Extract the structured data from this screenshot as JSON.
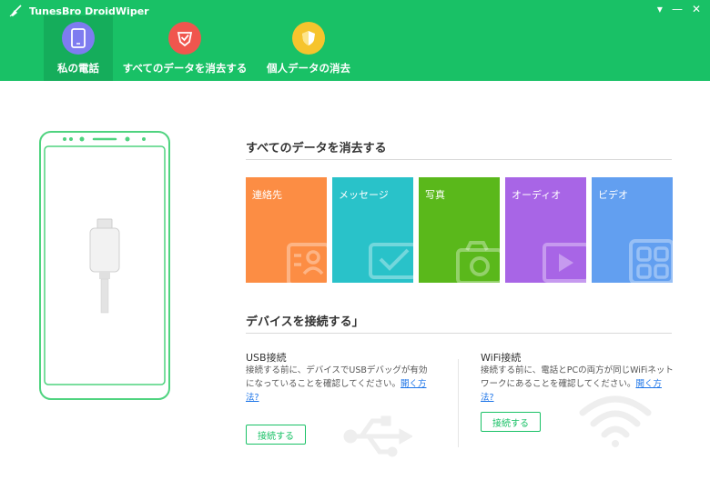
{
  "app": {
    "title": "TunesBro DroidWiper"
  },
  "window_controls": {
    "menu": "▾",
    "minimize": "—",
    "close": "✕"
  },
  "nav": [
    {
      "label": "私の電話",
      "icon": "phone-icon",
      "color": "#7e7cf0",
      "active": true
    },
    {
      "label": "すべてのデータを消去する",
      "icon": "shield-check-icon",
      "color": "#f0564e",
      "active": false
    },
    {
      "label": "個人データの消去",
      "icon": "shield-icon",
      "color": "#f6c42d",
      "active": false
    }
  ],
  "erase_section": {
    "title": "すべてのデータを消去する",
    "tiles": [
      {
        "label": "連絡先",
        "color": "#fc8d44",
        "icon": "contacts-icon"
      },
      {
        "label": "メッセージ",
        "color": "#29c2c9",
        "icon": "message-icon"
      },
      {
        "label": "写真",
        "color": "#5ab81b",
        "icon": "camera-icon"
      },
      {
        "label": "オーディオ",
        "color": "#a865e6",
        "icon": "play-icon"
      },
      {
        "label": "ビデオ",
        "color": "#629ff0",
        "icon": "grid-icon"
      }
    ]
  },
  "connect_section": {
    "title": "デバイスを接続する」",
    "usb": {
      "title": "USB接続",
      "desc_line1": "接続する前に、デバイスでUSBデバッグが有効",
      "desc_line2": "になっていることを確認してください。",
      "link_part1": "開く方",
      "link_part2": "法?",
      "button": "接続する"
    },
    "wifi": {
      "title": "WiFi接続",
      "desc_line1": "接続する前に、電話とPCの両方が同じWiFiネット",
      "desc_line2": "ワークにあることを確認してください。",
      "link_part1": "開く方",
      "link_part2": "法?",
      "button": "接続する"
    }
  },
  "colors": {
    "brand": "#19c166",
    "brand_dark": "#15ad5b",
    "phone_outline": "#4fd37f"
  }
}
